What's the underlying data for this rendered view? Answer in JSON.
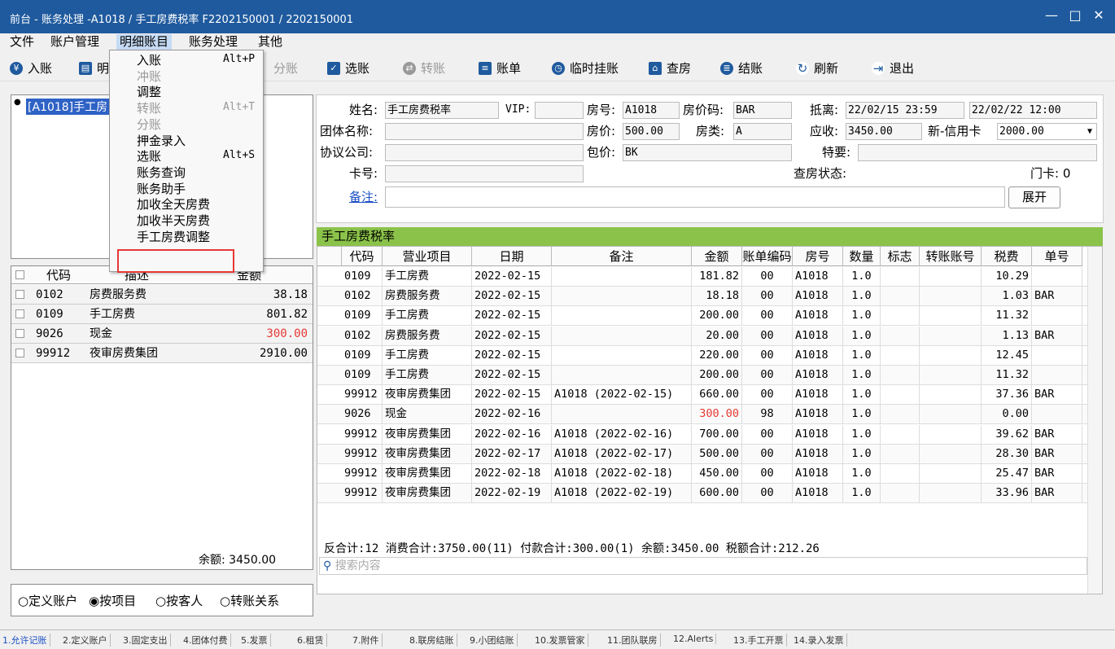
{
  "title": "前台 - 账务处理 -A1018 / 手工房费税率 F2202150001 / 2202150001",
  "window_controls": {
    "minimize": "—",
    "maximize": "□",
    "close": "✕"
  },
  "menubar": [
    "文件",
    "账户管理",
    "明细账目",
    "账务处理",
    "其他"
  ],
  "toolbar": [
    "入账",
    "明",
    "分账",
    "选账",
    "转账",
    "账单",
    "临时挂账",
    "查房",
    "结账",
    "刷新",
    "退出"
  ],
  "dropdown": {
    "items": [
      {
        "label": "入账",
        "shortcut": "Alt+P",
        "disabled": false
      },
      {
        "label": "冲账",
        "shortcut": "",
        "disabled": true
      },
      {
        "label": "调整",
        "shortcut": "",
        "disabled": false
      },
      {
        "label": "转账",
        "shortcut": "Alt+T",
        "disabled": true
      },
      {
        "label": "分账",
        "shortcut": "",
        "disabled": true
      },
      {
        "label": "押金录入",
        "shortcut": "",
        "disabled": false
      },
      {
        "label": "选账",
        "shortcut": "Alt+S",
        "disabled": false
      },
      {
        "label": "账务查询",
        "shortcut": "",
        "disabled": false
      },
      {
        "label": "账务助手",
        "shortcut": "",
        "disabled": false
      },
      {
        "label": "加收全天房费",
        "shortcut": "",
        "disabled": false
      },
      {
        "label": "加收半天房费",
        "shortcut": "",
        "disabled": false
      },
      {
        "label": "手工房费调整",
        "shortcut": "",
        "disabled": false
      }
    ]
  },
  "tree_node": "[A1018]手工房",
  "account_table": {
    "headers": [
      "代码",
      "描述",
      "金额"
    ],
    "rows": [
      [
        "0102",
        "房费服务费",
        "38.18"
      ],
      [
        "0109",
        "手工房费",
        "801.82"
      ],
      [
        "9026",
        "现金",
        "300.00"
      ],
      [
        "99912",
        "夜审房费集团",
        "2910.00"
      ]
    ],
    "balance": "余额: 3450.00"
  },
  "radios": {
    "options": [
      "定义账户",
      "按项目",
      "按客人",
      "转账关系"
    ],
    "selected": "按项目"
  },
  "info": {
    "name_label": "姓名:",
    "name": "手工房费税率",
    "vip_label": "VIP:",
    "vip": "",
    "room_label": "房号:",
    "room": "A1018",
    "rate_code_label": "房价码:",
    "rate_code": "BAR",
    "departure_label": "抵离:",
    "arrive": "22/02/15 23:59",
    "depart": "22/02/22 12:00",
    "group_label": "团体名称:",
    "group": "",
    "price_label": "房价:",
    "price": "500.00",
    "room_type_label": "房类:",
    "room_type": "A",
    "receivable_label": "应收:",
    "receivable": "3450.00",
    "credit_label": "新-信用卡",
    "credit": "2000.00",
    "company_label": "协议公司:",
    "company": "",
    "package_label": "包价:",
    "package": "BK",
    "special_label": "特要:",
    "special": "",
    "card_label": "卡号:",
    "card": "",
    "check_label": "查房状态:",
    "door_card": "门卡: 0",
    "remark_label": "备注:",
    "remark": "",
    "expand_button": "展开"
  },
  "detail_title": "手工房费税率",
  "detail": {
    "headers": [
      "代码",
      "营业项目",
      "日期",
      "备注",
      "金额",
      "账单编码",
      "房号",
      "数量",
      "标志",
      "转账账号",
      "税费",
      "单号"
    ],
    "rows": [
      [
        "0109",
        "手工房费",
        "2022-02-15",
        "",
        "181.82",
        "00",
        "A1018",
        "1.0",
        "",
        "",
        "10.29",
        ""
      ],
      [
        "0102",
        "房费服务费",
        "2022-02-15",
        "",
        "18.18",
        "00",
        "A1018",
        "1.0",
        "",
        "",
        "1.03",
        "BAR"
      ],
      [
        "0109",
        "手工房费",
        "2022-02-15",
        "",
        "200.00",
        "00",
        "A1018",
        "1.0",
        "",
        "",
        "11.32",
        ""
      ],
      [
        "0102",
        "房费服务费",
        "2022-02-15",
        "",
        "20.00",
        "00",
        "A1018",
        "1.0",
        "",
        "",
        "1.13",
        "BAR"
      ],
      [
        "0109",
        "手工房费",
        "2022-02-15",
        "",
        "220.00",
        "00",
        "A1018",
        "1.0",
        "",
        "",
        "12.45",
        ""
      ],
      [
        "0109",
        "手工房费",
        "2022-02-15",
        "",
        "200.00",
        "00",
        "A1018",
        "1.0",
        "",
        "",
        "11.32",
        ""
      ],
      [
        "99912",
        "夜审房费集团",
        "2022-02-15",
        "A1018 (2022-02-15)",
        "660.00",
        "00",
        "A1018",
        "1.0",
        "",
        "",
        "37.36",
        "BAR"
      ],
      [
        "9026",
        "现金",
        "2022-02-16",
        "",
        "300.00",
        "98",
        "A1018",
        "1.0",
        "",
        "",
        "0.00",
        ""
      ],
      [
        "99912",
        "夜审房费集团",
        "2022-02-16",
        "A1018 (2022-02-16)",
        "700.00",
        "00",
        "A1018",
        "1.0",
        "",
        "",
        "39.62",
        "BAR"
      ],
      [
        "99912",
        "夜审房费集团",
        "2022-02-17",
        "A1018 (2022-02-17)",
        "500.00",
        "00",
        "A1018",
        "1.0",
        "",
        "",
        "28.30",
        "BAR"
      ],
      [
        "99912",
        "夜审房费集团",
        "2022-02-18",
        "A1018 (2022-02-18)",
        "450.00",
        "00",
        "A1018",
        "1.0",
        "",
        "",
        "25.47",
        "BAR"
      ],
      [
        "99912",
        "夜审房费集团",
        "2022-02-19",
        "A1018 (2022-02-19)",
        "600.00",
        "00",
        "A1018",
        "1.0",
        "",
        "",
        "33.96",
        "BAR"
      ]
    ],
    "reverse_label": "反",
    "summary": "合计:12  消费合计:3750.00(11)  付款合计:300.00(1)  余额:3450.00  税额合计:212.26",
    "search_placeholder": "搜索内容"
  },
  "statusbar": [
    "1.允许记账",
    "2.定义账户",
    "3.固定支出",
    "4.团体付费",
    "5.发票",
    "6.租赁",
    "7.附件",
    "8.联房结账",
    "9.小团结账",
    "10.发票管家",
    "11.团队联房",
    "12.Alerts",
    "13.手工开票",
    "14.录入发票"
  ],
  "colors": {
    "title_bg": "#1f5a9e",
    "accent_green": "#8bc34a",
    "negative_red": "#e53935",
    "highlight_border": "#e53935"
  }
}
